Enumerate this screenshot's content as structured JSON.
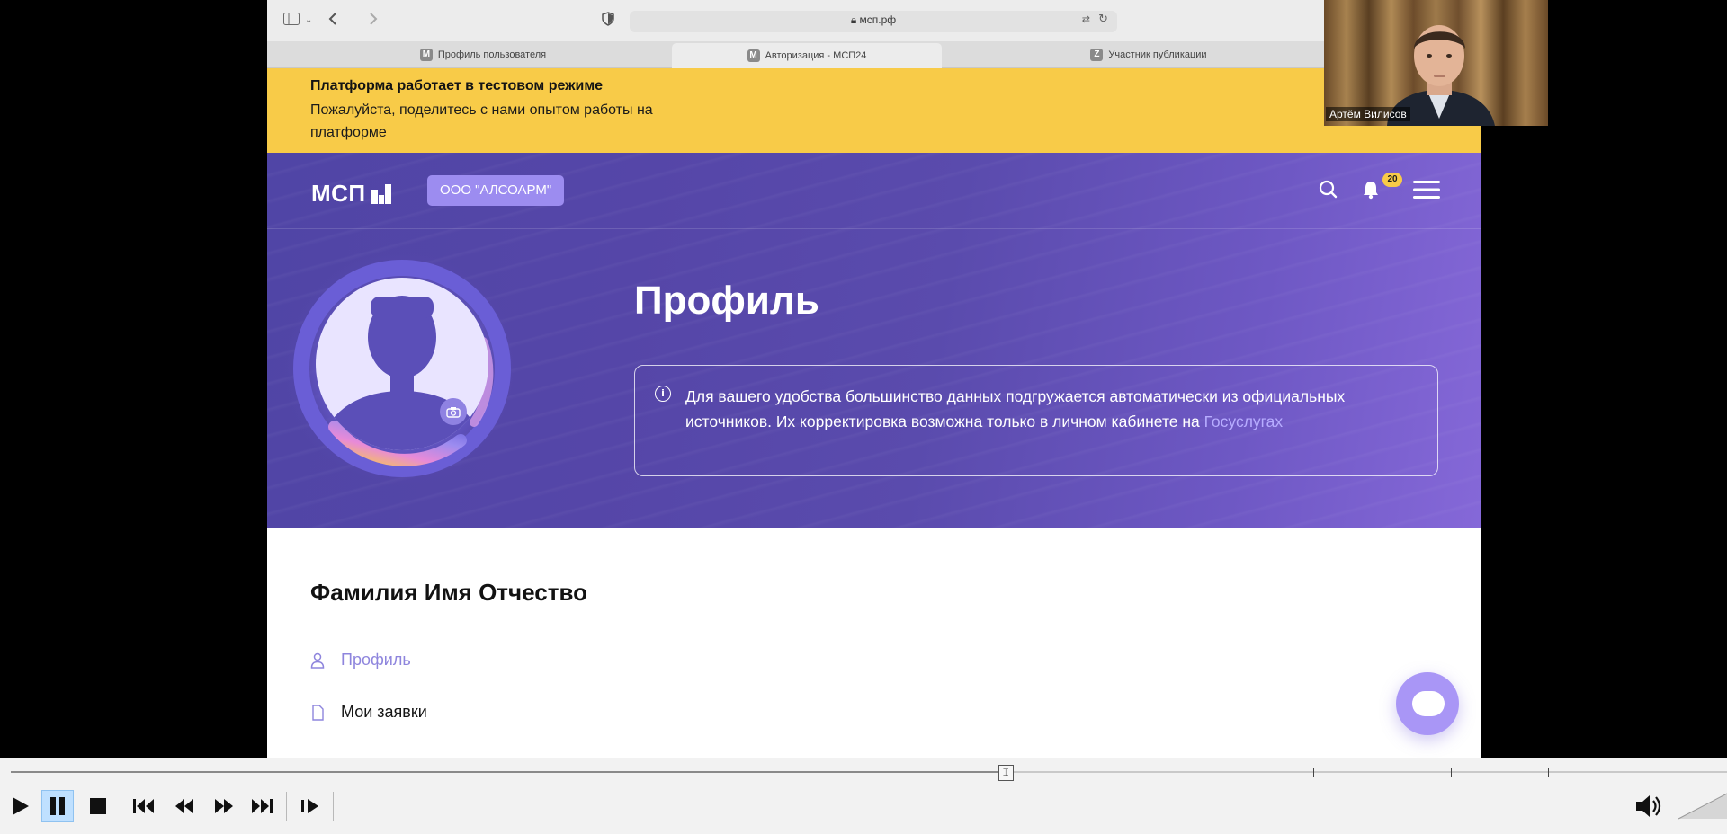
{
  "browser": {
    "url": "мсп.рф",
    "tabs": [
      {
        "label": "Профиль пользователя",
        "favicon": "М"
      },
      {
        "label": "Авторизация - МСП24",
        "favicon": "М"
      },
      {
        "label": "Участник публикации",
        "favicon": "Z"
      }
    ]
  },
  "banner": {
    "title": "Платформа работает в тестовом режиме",
    "text": "Пожалуйста, поделитесь с нами опытом работы на платформе"
  },
  "header": {
    "logo": "МСП",
    "company": "ООО \"АЛСОАРМ\"",
    "notifications_count": "20"
  },
  "profile": {
    "title": "Профиль",
    "info_text": "Для вашего удобства большинство данных подгружается автоматически из официальных источников. Их корректировка возможна только в личном кабинете на ",
    "info_link": "Госуслугах",
    "full_name": "Фамилия Имя Отчество",
    "menu": [
      {
        "label": "Профиль"
      },
      {
        "label": "Мои заявки"
      }
    ]
  },
  "webcam": {
    "name": "Артём Вилисов"
  },
  "player": {
    "progress": 0.58
  },
  "colors": {
    "banner": "#f8cb48",
    "hero": "#5546a8",
    "accent": "#9c8cf0",
    "link": "#b7acff"
  },
  "icons": [
    "sidebar-icon",
    "chevron-down-icon",
    "back-icon",
    "forward-icon",
    "shield-icon",
    "lock-icon",
    "translate-icon",
    "reload-icon",
    "search-icon",
    "bell-icon",
    "menu-icon",
    "camera-icon",
    "info-icon",
    "user-icon",
    "document-icon",
    "chat-icon",
    "play-icon",
    "pause-icon",
    "stop-icon",
    "skip-back-icon",
    "rewind-icon",
    "fast-forward-icon",
    "skip-forward-icon",
    "frame-step-icon",
    "volume-icon"
  ]
}
